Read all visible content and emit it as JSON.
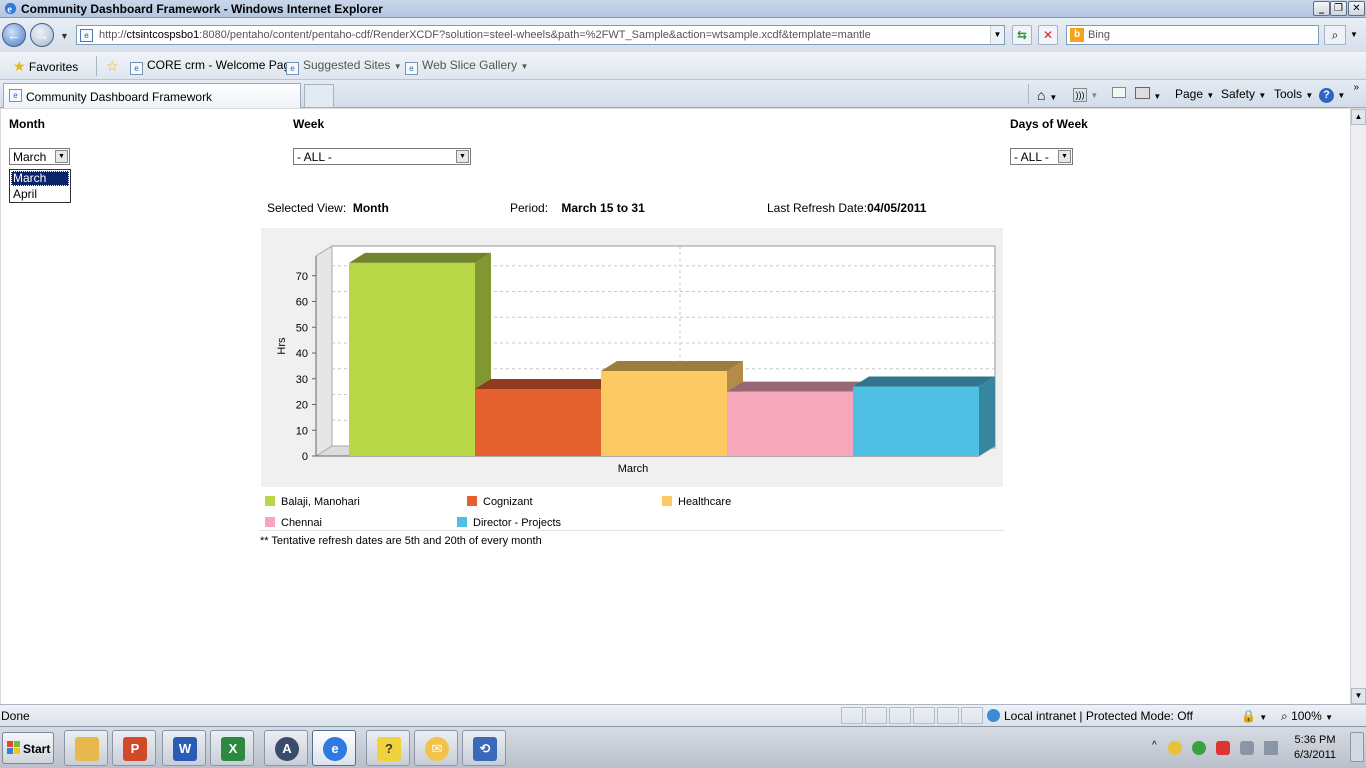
{
  "window": {
    "title": "Community Dashboard Framework - Windows Internet Explorer",
    "minimize": "_",
    "restore": "❐",
    "close": "✕"
  },
  "address": {
    "url_prefix": "http://",
    "url_host": "ctsintcospsbo1",
    "url_rest": ":8080/pentaho/content/pentaho-cdf/RenderXCDF?solution=steel-wheels&path=%2FWT_Sample&action=wtsample.xcdf&template=mantle",
    "search_placeholder": "Bing"
  },
  "favorites": {
    "favorites_label": "Favorites",
    "links": [
      "CORE crm - Welcome Page",
      "Suggested Sites",
      "Web Slice Gallery"
    ]
  },
  "tabs": {
    "active_tab": "Community Dashboard Framework"
  },
  "commands": {
    "page": "Page",
    "safety": "Safety",
    "tools": "Tools"
  },
  "filters": {
    "month_label": "Month",
    "week_label": "Week",
    "days_label": "Days of Week",
    "month_value": "March",
    "week_value": "- ALL -",
    "days_value": "- ALL -",
    "month_options": [
      "March",
      "April"
    ]
  },
  "info": {
    "selected_view_label": "Selected View:",
    "selected_view_value": "Month",
    "period_label": "Period:",
    "period_value": "March 15 to 31",
    "refresh_label": "Last Refresh Date:",
    "refresh_value": "04/05/2011"
  },
  "chart_data": {
    "type": "bar",
    "categories": [
      "March"
    ],
    "series": [
      {
        "name": "Balaji, Manohari",
        "values": [
          75
        ],
        "color": "#b8d747"
      },
      {
        "name": "Cognizant",
        "values": [
          26
        ],
        "color": "#e5602f"
      },
      {
        "name": "Healthcare",
        "values": [
          33
        ],
        "color": "#fdc965"
      },
      {
        "name": "Chennai",
        "values": [
          25
        ],
        "color": "#f6a7bc"
      },
      {
        "name": "Director - Projects",
        "values": [
          27
        ],
        "color": "#4fbfe4"
      }
    ],
    "ylabel": "Hrs",
    "xlabel": "",
    "ylim": [
      0,
      80
    ],
    "yticks": [
      "0",
      "10",
      "20",
      "30",
      "40",
      "50",
      "60",
      "70"
    ],
    "grid": true,
    "legend": "bottom"
  },
  "note": "** Tentative refresh dates are 5th and 20th of every month",
  "status": {
    "left": "Done",
    "zone": "Local intranet | Protected Mode: Off",
    "zoom": "100%"
  },
  "taskbar": {
    "start": "Start",
    "time": "5:36 PM",
    "date": "6/3/2011"
  }
}
